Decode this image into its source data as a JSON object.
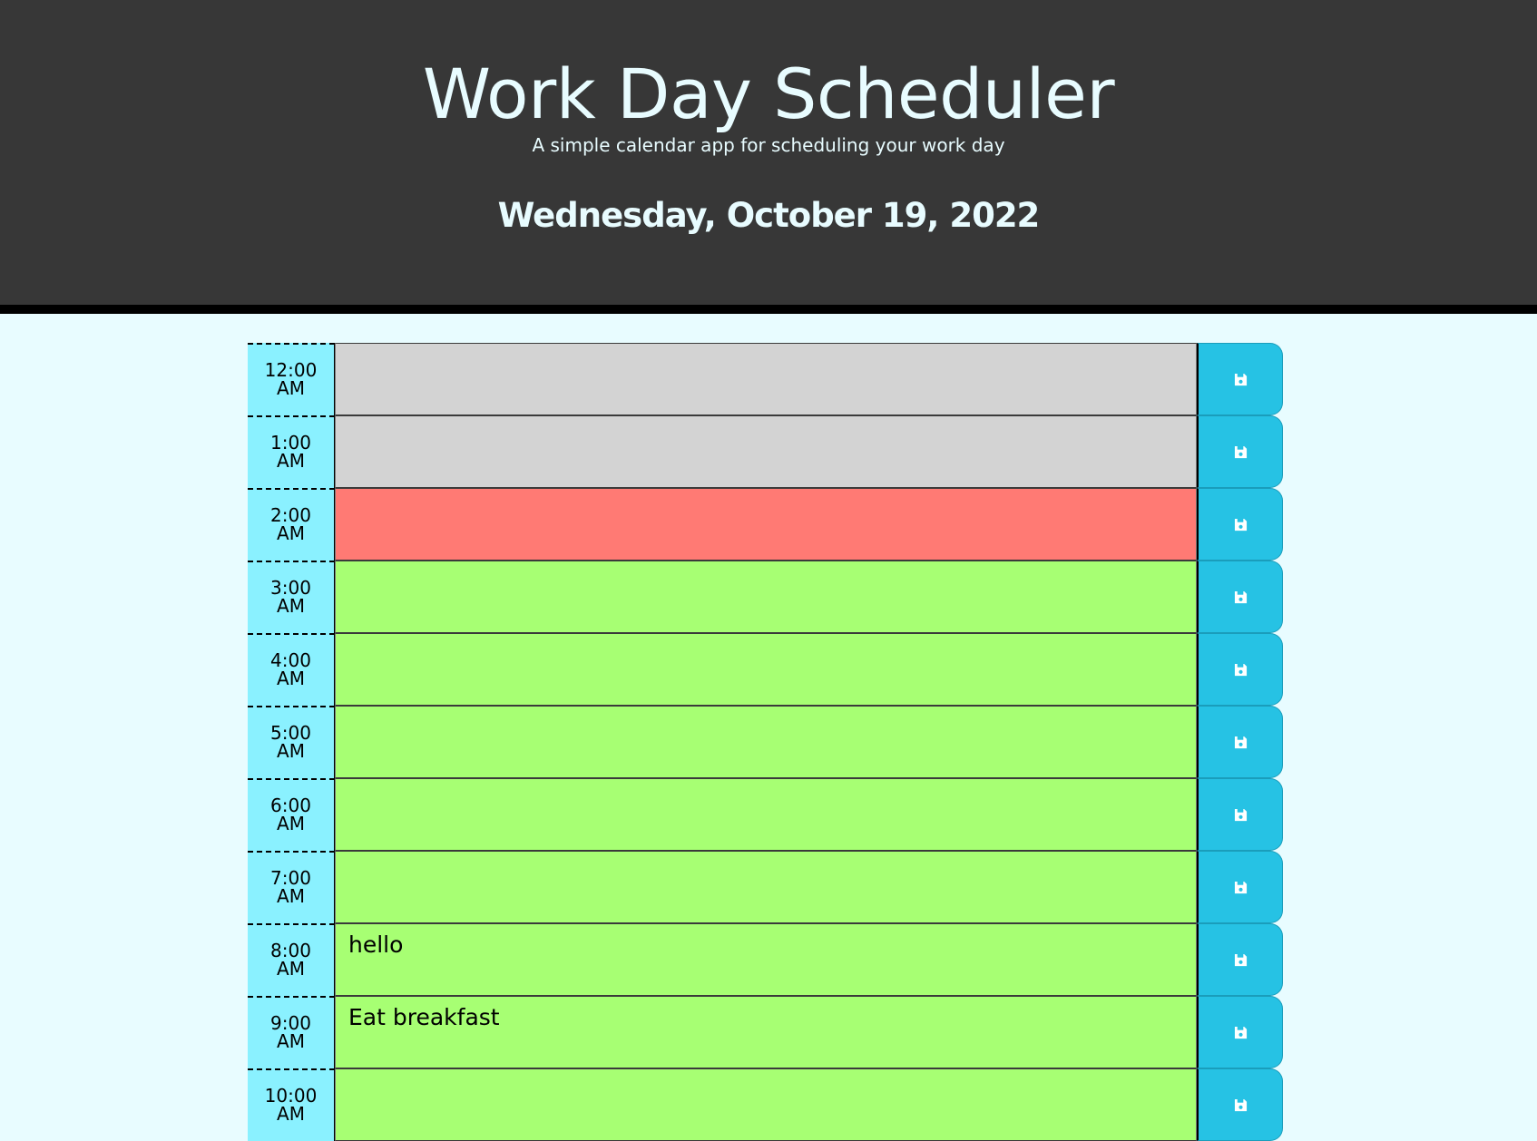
{
  "header": {
    "title": "Work Day Scheduler",
    "subtitle": "A simple calendar app for scheduling your work day",
    "current_date": "Wednesday, October 19, 2022"
  },
  "colors": {
    "header_bg": "#373737",
    "page_bg": "#e8fcff",
    "hour_bg": "#8af1ff",
    "past": "#d3d3d3",
    "present": "#ff7a74",
    "future": "#a7ff73",
    "save_bg": "#26c2e4"
  },
  "save_icon": "floppy-disk-icon",
  "timeblocks": [
    {
      "hour": "12:00",
      "period": "AM",
      "status": "past",
      "text": ""
    },
    {
      "hour": "1:00",
      "period": "AM",
      "status": "past",
      "text": ""
    },
    {
      "hour": "2:00",
      "period": "AM",
      "status": "present",
      "text": ""
    },
    {
      "hour": "3:00",
      "period": "AM",
      "status": "future",
      "text": ""
    },
    {
      "hour": "4:00",
      "period": "AM",
      "status": "future",
      "text": ""
    },
    {
      "hour": "5:00",
      "period": "AM",
      "status": "future",
      "text": ""
    },
    {
      "hour": "6:00",
      "period": "AM",
      "status": "future",
      "text": ""
    },
    {
      "hour": "7:00",
      "period": "AM",
      "status": "future",
      "text": ""
    },
    {
      "hour": "8:00",
      "period": "AM",
      "status": "future",
      "text": "hello"
    },
    {
      "hour": "9:00",
      "period": "AM",
      "status": "future",
      "text": "Eat breakfast"
    },
    {
      "hour": "10:00",
      "period": "AM",
      "status": "future",
      "text": ""
    }
  ]
}
